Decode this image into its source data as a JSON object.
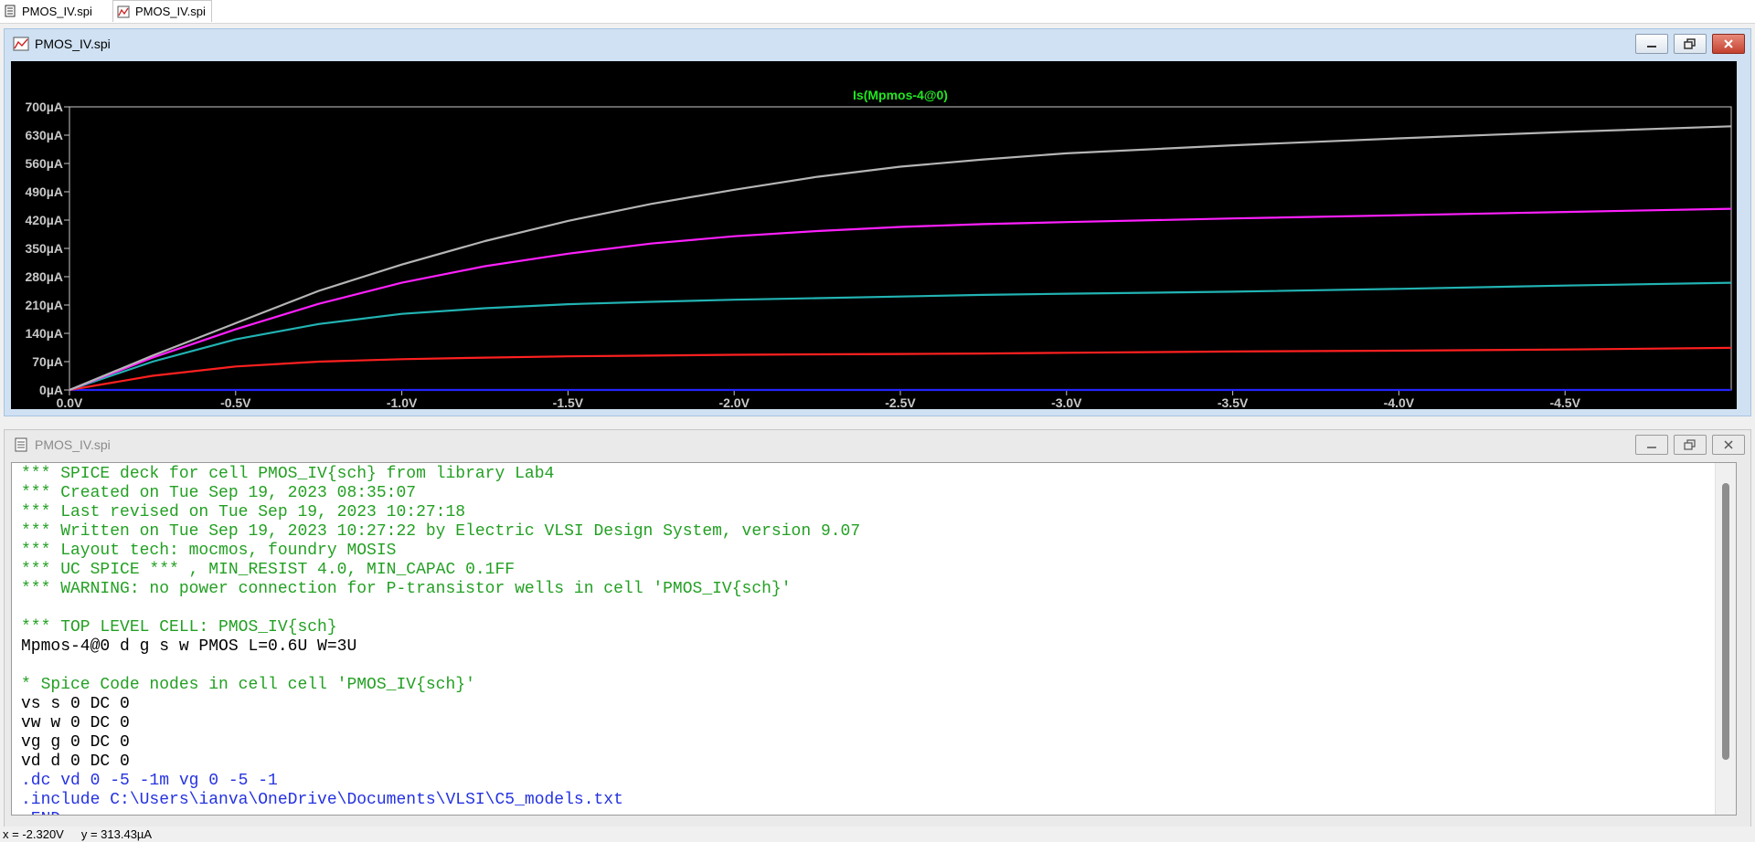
{
  "tabs": [
    {
      "label": "PMOS_IV.spi",
      "icon": "document-icon",
      "active": false
    },
    {
      "label": "PMOS_IV.spi",
      "icon": "waveform-icon",
      "active": true
    }
  ],
  "plot_window": {
    "title": "PMOS_IV.spi",
    "buttons": [
      "minimize",
      "maximize",
      "close"
    ]
  },
  "netlist_window": {
    "title": "PMOS_IV.spi",
    "buttons": [
      "minimize",
      "maximize",
      "close"
    ]
  },
  "colors": {
    "plot_bg": "#000000",
    "axis": "#c8c8c8",
    "trace_title": "#22e622",
    "comment": "#23a023",
    "directive": "#2432e0",
    "normal": "#000000"
  },
  "chart_data": {
    "type": "line",
    "title": "Is(Mpmos-4@0)",
    "xlabel": "",
    "ylabel": "",
    "xlim": [
      0,
      -5
    ],
    "ylim": [
      0,
      700
    ],
    "x_ticks": [
      "0.0V",
      "-0.5V",
      "-1.0V",
      "-1.5V",
      "-2.0V",
      "-2.5V",
      "-3.0V",
      "-3.5V",
      "-4.0V",
      "-4.5V"
    ],
    "x_tick_values": [
      0,
      -0.5,
      -1.0,
      -1.5,
      -2.0,
      -2.5,
      -3.0,
      -3.5,
      -4.0,
      -4.5
    ],
    "y_ticks": [
      "0µA",
      "70µA",
      "140µA",
      "210µA",
      "280µA",
      "350µA",
      "420µA",
      "490µA",
      "560µA",
      "630µA",
      "700µA"
    ],
    "y_tick_values": [
      0,
      70,
      140,
      210,
      280,
      350,
      420,
      490,
      560,
      630,
      700
    ],
    "grid": false,
    "x": [
      0,
      -0.25,
      -0.5,
      -0.75,
      -1.0,
      -1.25,
      -1.5,
      -1.75,
      -2.0,
      -2.25,
      -2.5,
      -2.75,
      -3.0,
      -3.5,
      -4.0,
      -4.5,
      -5.0
    ],
    "series": [
      {
        "color": "#2424ff",
        "values": [
          0,
          0,
          0,
          0,
          0,
          0,
          0,
          0,
          0,
          0,
          0,
          0,
          0,
          0,
          0,
          0,
          0
        ]
      },
      {
        "color": "#ff2020",
        "values": [
          0,
          35,
          58,
          70,
          76,
          80,
          83,
          85,
          87,
          88,
          89,
          90,
          92,
          95,
          97,
          100,
          104
        ]
      },
      {
        "color": "#22b3b3",
        "values": [
          0,
          70,
          125,
          163,
          188,
          202,
          212,
          218,
          223,
          227,
          231,
          235,
          238,
          243,
          250,
          258,
          265
        ]
      },
      {
        "color": "#ff20ff",
        "values": [
          0,
          80,
          150,
          213,
          265,
          306,
          337,
          362,
          380,
          393,
          403,
          410,
          415,
          424,
          432,
          440,
          448
        ]
      },
      {
        "color": "#b5b5b5",
        "values": [
          0,
          85,
          165,
          245,
          310,
          368,
          418,
          460,
          495,
          527,
          552,
          570,
          585,
          605,
          622,
          638,
          652
        ]
      }
    ]
  },
  "netlist": [
    {
      "text": "*** SPICE deck for cell PMOS_IV{sch} from library Lab4",
      "kind": "comment"
    },
    {
      "text": "*** Created on Tue Sep 19, 2023 08:35:07",
      "kind": "comment"
    },
    {
      "text": "*** Last revised on Tue Sep 19, 2023 10:27:18",
      "kind": "comment"
    },
    {
      "text": "*** Written on Tue Sep 19, 2023 10:27:22 by Electric VLSI Design System, version 9.07",
      "kind": "comment"
    },
    {
      "text": "*** Layout tech: mocmos, foundry MOSIS",
      "kind": "comment"
    },
    {
      "text": "*** UC SPICE *** , MIN_RESIST 4.0, MIN_CAPAC 0.1FF",
      "kind": "comment"
    },
    {
      "text": "*** WARNING: no power connection for P-transistor wells in cell 'PMOS_IV{sch}'",
      "kind": "comment"
    },
    {
      "text": "",
      "kind": "normal"
    },
    {
      "text": "*** TOP LEVEL CELL: PMOS_IV{sch}",
      "kind": "comment"
    },
    {
      "text": "Mpmos-4@0 d g s w PMOS L=0.6U W=3U",
      "kind": "normal"
    },
    {
      "text": "",
      "kind": "normal"
    },
    {
      "text": "* Spice Code nodes in cell cell 'PMOS_IV{sch}'",
      "kind": "comment"
    },
    {
      "text": "vs s 0 DC 0",
      "kind": "normal"
    },
    {
      "text": "vw w 0 DC 0",
      "kind": "normal"
    },
    {
      "text": "vg g 0 DC 0",
      "kind": "normal"
    },
    {
      "text": "vd d 0 DC 0",
      "kind": "normal"
    },
    {
      "text": ".dc vd 0 -5 -1m vg 0 -5 -1",
      "kind": "directive"
    },
    {
      "text": ".include C:\\Users\\ianva\\OneDrive\\Documents\\VLSI\\C5_models.txt",
      "kind": "directive"
    },
    {
      "text": ".END",
      "kind": "directive"
    }
  ],
  "status": {
    "x_readout": "x = -2.320V",
    "y_readout": "y = 313.43µA"
  }
}
